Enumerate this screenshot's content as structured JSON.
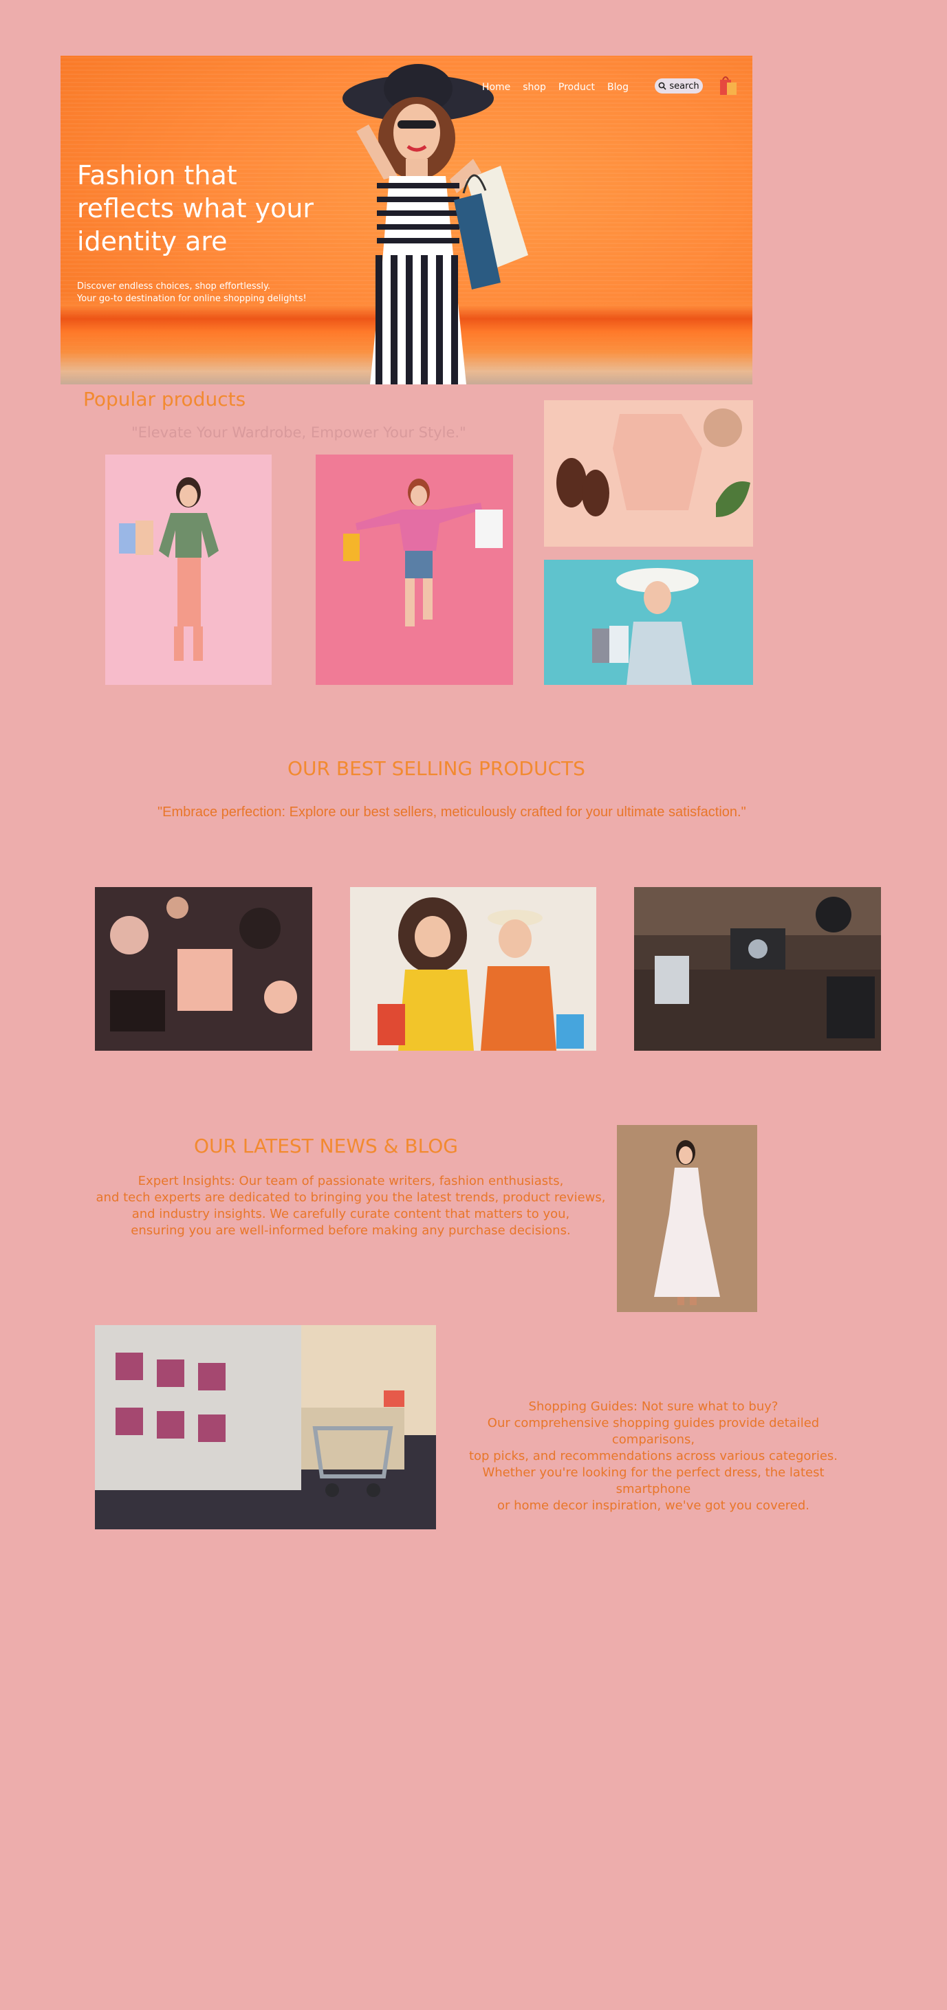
{
  "hero": {
    "nav": [
      "Home",
      "shop",
      "Product",
      "Blog"
    ],
    "search_label": "search",
    "title": "Fashion that reflects what your identity are",
    "subtitle_line1": "Discover endless choices, shop effortlessly.",
    "subtitle_line2": "Your go-to destination for online shopping delights!"
  },
  "popular": {
    "title": "Popular products",
    "tagline": "\"Elevate Your Wardrobe, Empower Your Style.\""
  },
  "best": {
    "title": "OUR BEST SELLING PRODUCTS",
    "tagline": "\"Embrace perfection: Explore our best sellers, meticulously crafted for your ultimate satisfaction.\""
  },
  "news": {
    "title": "OUR LATEST NEWS & BLOG",
    "lines": [
      "Expert Insights: Our team of passionate writers, fashion enthusiasts,",
      "and tech experts are dedicated to bringing you the latest trends, product reviews,",
      "and industry insights. We carefully curate content that matters to you,",
      "ensuring you are well-informed before making any purchase decisions."
    ]
  },
  "guides": {
    "lines": [
      "Shopping Guides: Not sure what to buy?",
      "Our comprehensive shopping guides provide detailed comparisons,",
      "top picks, and recommendations across various categories.",
      "Whether you're looking for the perfect dress, the latest smartphone",
      "or home decor inspiration, we've got you covered."
    ]
  },
  "colors": {
    "background": "#edadac",
    "accent_orange": "#f28a30",
    "text_orange": "#e8762a",
    "hero_orange": "#ff8a3a"
  }
}
